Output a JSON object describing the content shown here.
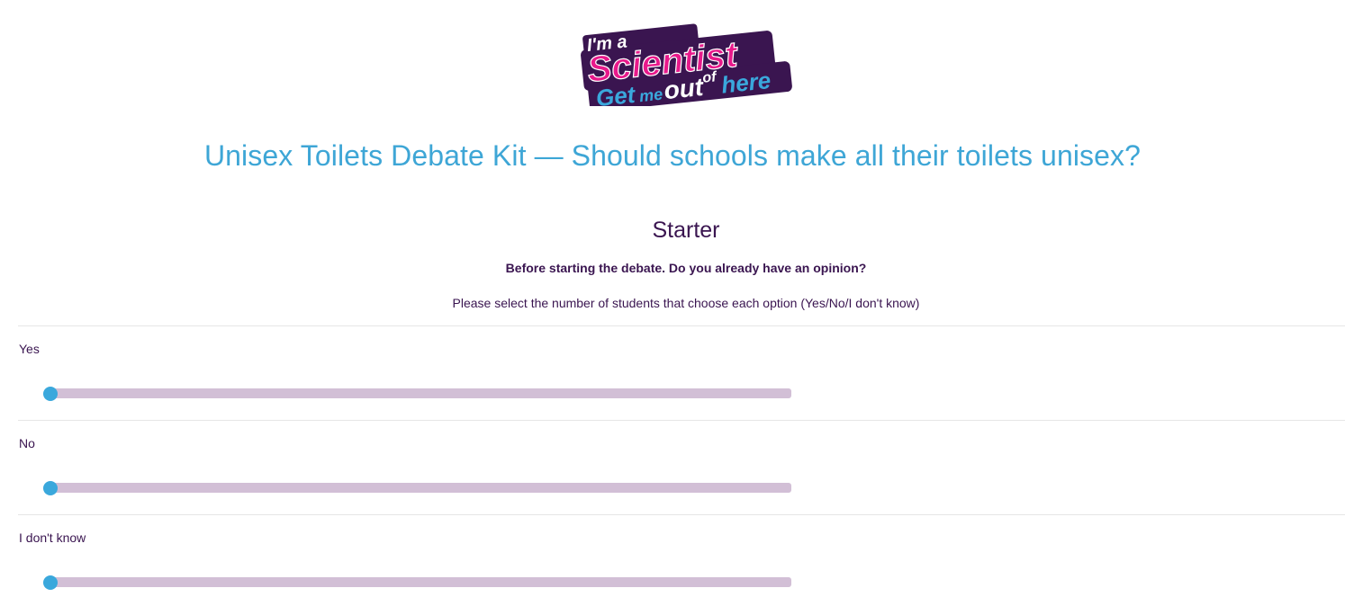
{
  "logo": {
    "line1_small": "I'm a",
    "line2": "Scientist",
    "line3_get": "Get",
    "line3_me": "me",
    "line3_out": "out",
    "line3_of": "of",
    "line3_here": "here"
  },
  "title": "Unisex Toilets Debate Kit — Should schools make all their toilets unisex?",
  "section": {
    "heading": "Starter",
    "question": "Before starting the debate. Do you already have an opinion?",
    "instruction": "Please select the number of students that choose each option (Yes/No/I don't know)"
  },
  "options": [
    {
      "label": "Yes",
      "value": 0
    },
    {
      "label": "No",
      "value": 0
    },
    {
      "label": "I don't know",
      "value": 0
    }
  ],
  "colors": {
    "title": "#3ea6d6",
    "text": "#3a1550",
    "slider_track": "#d2bfd6",
    "slider_thumb": "#3aa8dc",
    "logo_pink": "#e8198b",
    "logo_purple": "#3a1550",
    "logo_blue": "#3aa8dc"
  }
}
